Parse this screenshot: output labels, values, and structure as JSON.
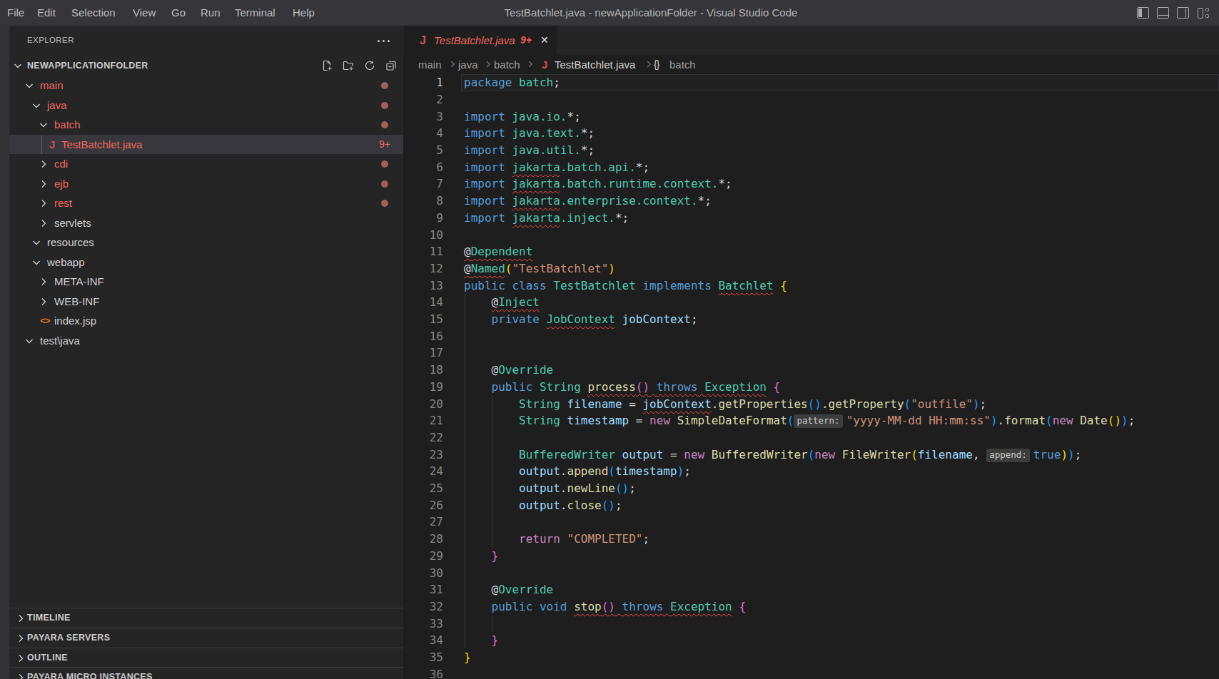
{
  "colors": {
    "accent_error": "#f0685c",
    "badge_dot": "#a0605c",
    "editor_bg": "#1e1e1e",
    "sidebar_bg": "#252526",
    "titlebar_bg": "#35353a",
    "selection_row": "#37373d",
    "squiggle": "#f14c4c"
  },
  "titlebar": {
    "menus": [
      "File",
      "Edit",
      "Selection",
      "View",
      "Go",
      "Run",
      "Terminal",
      "Help"
    ],
    "title": "TestBatchlet.java - newApplicationFolder - Visual Studio Code",
    "window_icons": [
      "layout-sidebar-left-icon",
      "layout-panel-icon",
      "layout-sidebar-right-icon",
      "customize-layout-icon"
    ]
  },
  "sidebar": {
    "explorer_label": "EXPLORER",
    "ellipsis_icon": "more-actions-icon",
    "section": {
      "title": "NEWAPPLICATIONFOLDER",
      "actions": [
        "new-file-icon",
        "new-folder-icon",
        "refresh-icon",
        "collapse-all-icon"
      ]
    },
    "tree": [
      {
        "label": "main",
        "level": 1,
        "chevron": "down",
        "error": true,
        "badge": "dot"
      },
      {
        "label": "java",
        "level": 2,
        "chevron": "down",
        "error": true,
        "badge": "dot"
      },
      {
        "label": "batch",
        "level": 3,
        "chevron": "down",
        "error": true,
        "badge": "dot"
      },
      {
        "label": "TestBatchlet.java",
        "level": 4,
        "chevron": "none",
        "error": true,
        "badge": "9+",
        "icon": "java",
        "selected": true
      },
      {
        "label": "cdi",
        "level": 3,
        "chevron": "right",
        "error": true,
        "badge": "dot"
      },
      {
        "label": "ejb",
        "level": 3,
        "chevron": "right",
        "error": true,
        "badge": "dot"
      },
      {
        "label": "rest",
        "level": 3,
        "chevron": "right",
        "error": true,
        "badge": "dot"
      },
      {
        "label": "servlets",
        "level": 3,
        "chevron": "right",
        "error": false
      },
      {
        "label": "resources",
        "level": 2,
        "chevron": "down",
        "error": false
      },
      {
        "label": "webapp",
        "level": 2,
        "chevron": "down",
        "error": false
      },
      {
        "label": "META-INF",
        "level": 3,
        "chevron": "right",
        "error": false
      },
      {
        "label": "WEB-INF",
        "level": 3,
        "chevron": "right",
        "error": false
      },
      {
        "label": "index.jsp",
        "level": 3,
        "chevron": "none",
        "error": false,
        "icon": "jsp"
      },
      {
        "label": "test\\java",
        "level": 1,
        "chevron": "down",
        "error": false
      }
    ],
    "bottom_sections": [
      "TIMELINE",
      "PAYARA SERVERS",
      "OUTLINE",
      "PAYARA MICRO INSTANCES"
    ]
  },
  "tab": {
    "icon": "java-file-icon",
    "label": "TestBatchlet.java",
    "badge": "9+",
    "close": "✕"
  },
  "breadcrumbs": [
    {
      "label": "main",
      "type": "path"
    },
    {
      "label": "java",
      "type": "path"
    },
    {
      "label": "batch",
      "type": "path"
    },
    {
      "label": "TestBatchlet.java",
      "type": "file",
      "icon": "java-file-icon"
    },
    {
      "label": "batch",
      "type": "symbol",
      "icon": "braces-icon"
    }
  ],
  "editor": {
    "line_count": 36,
    "cursor_line": 1,
    "lines": {
      "1": [
        [
          "package",
          "kw"
        ],
        [
          " ",
          "fg"
        ],
        [
          "batch",
          "typ"
        ],
        [
          ";",
          "fg"
        ]
      ],
      "3": [
        [
          "import",
          "kw"
        ],
        [
          " ",
          "fg"
        ],
        [
          "java.io.",
          "typ"
        ],
        [
          "*;",
          "fg"
        ]
      ],
      "4": [
        [
          "import",
          "kw"
        ],
        [
          " ",
          "fg"
        ],
        [
          "java.text.",
          "typ"
        ],
        [
          "*;",
          "fg"
        ]
      ],
      "5": [
        [
          "import",
          "kw"
        ],
        [
          " ",
          "fg"
        ],
        [
          "java.util.",
          "typ"
        ],
        [
          "*;",
          "fg"
        ]
      ],
      "6": [
        [
          "import",
          "kw"
        ],
        [
          " ",
          "fg"
        ],
        [
          "jakarta",
          "typ e"
        ],
        [
          ".batch.api.",
          "typ"
        ],
        [
          "*;",
          "fg"
        ]
      ],
      "7": [
        [
          "import",
          "kw"
        ],
        [
          " ",
          "fg"
        ],
        [
          "jakarta",
          "typ e"
        ],
        [
          ".batch.runtime.context.",
          "typ"
        ],
        [
          "*;",
          "fg"
        ]
      ],
      "8": [
        [
          "import",
          "kw"
        ],
        [
          " ",
          "fg"
        ],
        [
          "jakarta",
          "typ e"
        ],
        [
          ".enterprise.context.",
          "typ"
        ],
        [
          "*;",
          "fg"
        ]
      ],
      "9": [
        [
          "import",
          "kw"
        ],
        [
          " ",
          "fg"
        ],
        [
          "jakarta",
          "typ e"
        ],
        [
          ".inject.",
          "typ"
        ],
        [
          "*;",
          "fg"
        ]
      ],
      "11": [
        [
          "@",
          "fg e"
        ],
        [
          "Dependent",
          "typ e"
        ]
      ],
      "12": [
        [
          "@",
          "fg e"
        ],
        [
          "Named",
          "typ e"
        ],
        [
          "(",
          "p1"
        ],
        [
          "\"TestBatchlet\"",
          "str"
        ],
        [
          ")",
          "p1"
        ]
      ],
      "13": [
        [
          "public",
          "kw"
        ],
        [
          " ",
          "fg"
        ],
        [
          "class",
          "kw"
        ],
        [
          " ",
          "fg"
        ],
        [
          "TestBatchlet",
          "typ"
        ],
        [
          " ",
          "fg"
        ],
        [
          "implements",
          "kw"
        ],
        [
          " ",
          "fg"
        ],
        [
          "Batchlet",
          "typ e"
        ],
        [
          " ",
          "fg"
        ],
        [
          "{",
          "p1"
        ]
      ],
      "14": [
        [
          "    ",
          "fg"
        ],
        [
          "@",
          "fg e"
        ],
        [
          "Inject",
          "typ e"
        ]
      ],
      "15": [
        [
          "    ",
          "fg"
        ],
        [
          "private",
          "kw"
        ],
        [
          " ",
          "fg"
        ],
        [
          "JobContext",
          "typ e"
        ],
        [
          " ",
          "fg"
        ],
        [
          "jobContext",
          "var"
        ],
        [
          ";",
          "fg"
        ]
      ],
      "18": [
        [
          "    ",
          "fg"
        ],
        [
          "@",
          "fg"
        ],
        [
          "Override",
          "typ"
        ]
      ],
      "19": [
        [
          "    ",
          "fg"
        ],
        [
          "public",
          "kw"
        ],
        [
          " ",
          "fg"
        ],
        [
          "String",
          "typ"
        ],
        [
          " ",
          "fg"
        ],
        [
          "process",
          "fn e"
        ],
        [
          "(",
          "p2 e"
        ],
        [
          ")",
          "p2 e"
        ],
        [
          " ",
          "fg e"
        ],
        [
          "throws",
          "kw e"
        ],
        [
          " ",
          "fg e"
        ],
        [
          "Exception",
          "typ e"
        ],
        [
          " ",
          "fg"
        ],
        [
          "{",
          "p2"
        ]
      ],
      "20": [
        [
          "        ",
          "fg"
        ],
        [
          "String",
          "typ"
        ],
        [
          " ",
          "fg"
        ],
        [
          "filename",
          "var"
        ],
        [
          " = ",
          "fg"
        ],
        [
          "jobContext",
          "var e"
        ],
        [
          ".",
          "fg"
        ],
        [
          "getProperties",
          "fn"
        ],
        [
          "(",
          "p3"
        ],
        [
          ")",
          "p3"
        ],
        [
          ".",
          "fg"
        ],
        [
          "getProperty",
          "fn"
        ],
        [
          "(",
          "p3"
        ],
        [
          "\"outfile\"",
          "str"
        ],
        [
          ")",
          "p3"
        ],
        [
          ";",
          "fg"
        ]
      ],
      "21": [
        [
          "        ",
          "fg"
        ],
        [
          "String",
          "typ"
        ],
        [
          " ",
          "fg"
        ],
        [
          "timestamp",
          "var"
        ],
        [
          " = ",
          "fg"
        ],
        [
          "new",
          "ctl"
        ],
        [
          " ",
          "fg"
        ],
        [
          "SimpleDateFormat",
          "fn"
        ],
        [
          "(",
          "p3"
        ],
        [
          "pattern:",
          "inlay"
        ],
        [
          "\"yyyy-MM-dd HH:mm:ss\"",
          "str"
        ],
        [
          ")",
          "p3"
        ],
        [
          ".",
          "fg"
        ],
        [
          "format",
          "fn"
        ],
        [
          "(",
          "p3"
        ],
        [
          "new",
          "ctl"
        ],
        [
          " ",
          "fg"
        ],
        [
          "Date",
          "fn"
        ],
        [
          "(",
          "p1"
        ],
        [
          ")",
          "p1"
        ],
        [
          ")",
          "p3"
        ],
        [
          ";",
          "fg"
        ]
      ],
      "23": [
        [
          "        ",
          "fg"
        ],
        [
          "BufferedWriter",
          "typ"
        ],
        [
          " ",
          "fg"
        ],
        [
          "output",
          "var"
        ],
        [
          " = ",
          "fg"
        ],
        [
          "new",
          "ctl"
        ],
        [
          " ",
          "fg"
        ],
        [
          "BufferedWriter",
          "fn"
        ],
        [
          "(",
          "p3"
        ],
        [
          "new",
          "ctl"
        ],
        [
          " ",
          "fg"
        ],
        [
          "FileWriter",
          "fn"
        ],
        [
          "(",
          "p1"
        ],
        [
          "filename",
          "var"
        ],
        [
          ", ",
          "fg"
        ],
        [
          "append:",
          "inlay"
        ],
        [
          "true",
          "kw"
        ],
        [
          ")",
          "p1"
        ],
        [
          ")",
          "p3"
        ],
        [
          ";",
          "fg"
        ]
      ],
      "24": [
        [
          "        ",
          "fg"
        ],
        [
          "output",
          "var"
        ],
        [
          ".",
          "fg"
        ],
        [
          "append",
          "fn"
        ],
        [
          "(",
          "p3"
        ],
        [
          "timestamp",
          "var"
        ],
        [
          ")",
          "p3"
        ],
        [
          ";",
          "fg"
        ]
      ],
      "25": [
        [
          "        ",
          "fg"
        ],
        [
          "output",
          "var"
        ],
        [
          ".",
          "fg"
        ],
        [
          "newLine",
          "fn"
        ],
        [
          "(",
          "p3"
        ],
        [
          ")",
          "p3"
        ],
        [
          ";",
          "fg"
        ]
      ],
      "26": [
        [
          "        ",
          "fg"
        ],
        [
          "output",
          "var"
        ],
        [
          ".",
          "fg"
        ],
        [
          "close",
          "fn"
        ],
        [
          "(",
          "p3"
        ],
        [
          ")",
          "p3"
        ],
        [
          ";",
          "fg"
        ]
      ],
      "28": [
        [
          "        ",
          "fg"
        ],
        [
          "return",
          "ctl"
        ],
        [
          " ",
          "fg"
        ],
        [
          "\"COMPLETED\"",
          "str"
        ],
        [
          ";",
          "fg"
        ]
      ],
      "29": [
        [
          "    ",
          "fg"
        ],
        [
          "}",
          "p2"
        ]
      ],
      "31": [
        [
          "    ",
          "fg"
        ],
        [
          "@",
          "fg"
        ],
        [
          "Override",
          "typ"
        ]
      ],
      "32": [
        [
          "    ",
          "fg"
        ],
        [
          "public",
          "kw"
        ],
        [
          " ",
          "fg"
        ],
        [
          "void",
          "kw"
        ],
        [
          " ",
          "fg"
        ],
        [
          "stop",
          "fn e"
        ],
        [
          "(",
          "p2 e"
        ],
        [
          ")",
          "p2 e"
        ],
        [
          " ",
          "fg e"
        ],
        [
          "throws",
          "kw e"
        ],
        [
          " ",
          "fg e"
        ],
        [
          "Exception",
          "typ e"
        ],
        [
          " ",
          "fg"
        ],
        [
          "{",
          "p2"
        ]
      ],
      "34": [
        [
          "    ",
          "fg"
        ],
        [
          "}",
          "p2"
        ]
      ],
      "35": [
        [
          "}",
          "p1"
        ]
      ]
    }
  }
}
